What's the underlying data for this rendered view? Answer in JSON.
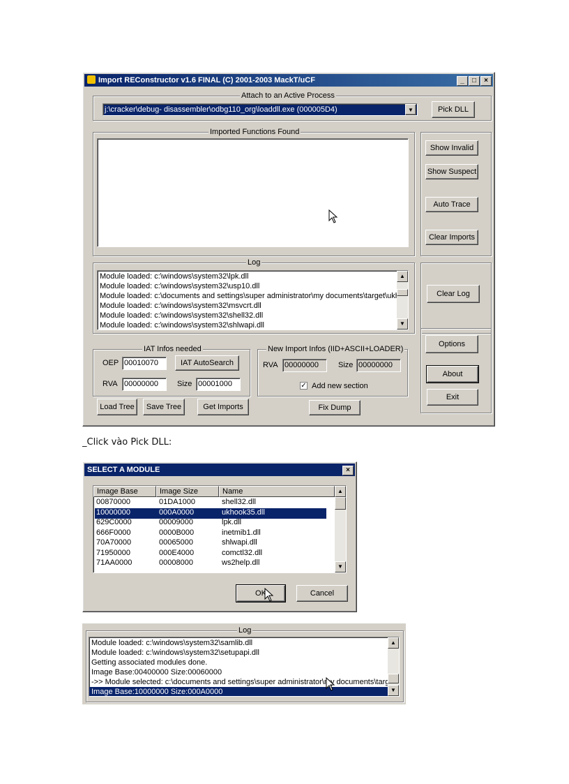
{
  "main_window": {
    "title": "Import REConstructor v1.6 FINAL (C) 2001-2003 MackT/uCF",
    "attach_group": "Attach to an Active Process",
    "process_value": "j:\\cracker\\debug- disassembler\\odbg110_org\\loaddll.exe (000005D4)",
    "pick_dll": "Pick DLL",
    "imported_group": "Imported Functions Found",
    "show_invalid": "Show Invalid",
    "show_suspect": "Show Suspect",
    "auto_trace": "Auto Trace",
    "clear_imports": "Clear Imports",
    "log_group": "Log",
    "log_lines": [
      "Module loaded: c:\\windows\\system32\\lpk.dll",
      "Module loaded: c:\\windows\\system32\\usp10.dll",
      "Module loaded: c:\\documents and settings\\super administrator\\my documents\\target\\ukh",
      "Module loaded: c:\\windows\\system32\\msvcrt.dll",
      "Module loaded: c:\\windows\\system32\\shell32.dll",
      "Module loaded: c:\\windows\\system32\\shlwapi.dll"
    ],
    "clear_log": "Clear Log",
    "iat_group": "IAT Infos needed",
    "oep_label": "OEP",
    "oep_value": "00010070",
    "iat_autosearch": "IAT AutoSearch",
    "rva_label": "RVA",
    "rva_value": "00000000",
    "size_label": "Size",
    "size_value": "00001000",
    "new_import_group": "New Import Infos (IID+ASCII+LOADER)",
    "ni_rva_label": "RVA",
    "ni_rva_value": "00000000",
    "ni_size_label": "Size",
    "ni_size_value": "00000000",
    "add_new_section": "Add new section",
    "add_new_section_checked": true,
    "options": "Options",
    "about": "About",
    "exit": "Exit",
    "load_tree": "Load Tree",
    "save_tree": "Save Tree",
    "get_imports": "Get Imports",
    "fix_dump": "Fix Dump"
  },
  "caption": "_Click vào Pick DLL:",
  "select_module": {
    "title": "SELECT A MODULE",
    "columns": [
      "Image Base",
      "Image Size",
      "Name"
    ],
    "rows": [
      [
        "00870000",
        "01DA1000",
        "shell32.dll"
      ],
      [
        "10000000",
        "000A0000",
        "ukhook35.dll"
      ],
      [
        "629C0000",
        "00009000",
        "lpk.dll"
      ],
      [
        "666F0000",
        "0000B000",
        "inetmib1.dll"
      ],
      [
        "70A70000",
        "00065000",
        "shlwapi.dll"
      ],
      [
        "71950000",
        "000E4000",
        "comctl32.dll"
      ],
      [
        "71AA0000",
        "00008000",
        "ws2help.dll"
      ]
    ],
    "selected_row": 1,
    "ok": "OK",
    "cancel": "Cancel"
  },
  "log_panel": {
    "label": "Log",
    "lines": [
      "Module loaded: c:\\windows\\system32\\samlib.dll",
      "Module loaded: c:\\windows\\system32\\setupapi.dll",
      "Getting associated modules done.",
      "Image Base:00400000 Size:00060000",
      "->> Module selected: c:\\documents and settings\\super administrator\\my documents\\targe",
      "Image Base:10000000 Size:000A0000"
    ],
    "selected_line": 5
  }
}
